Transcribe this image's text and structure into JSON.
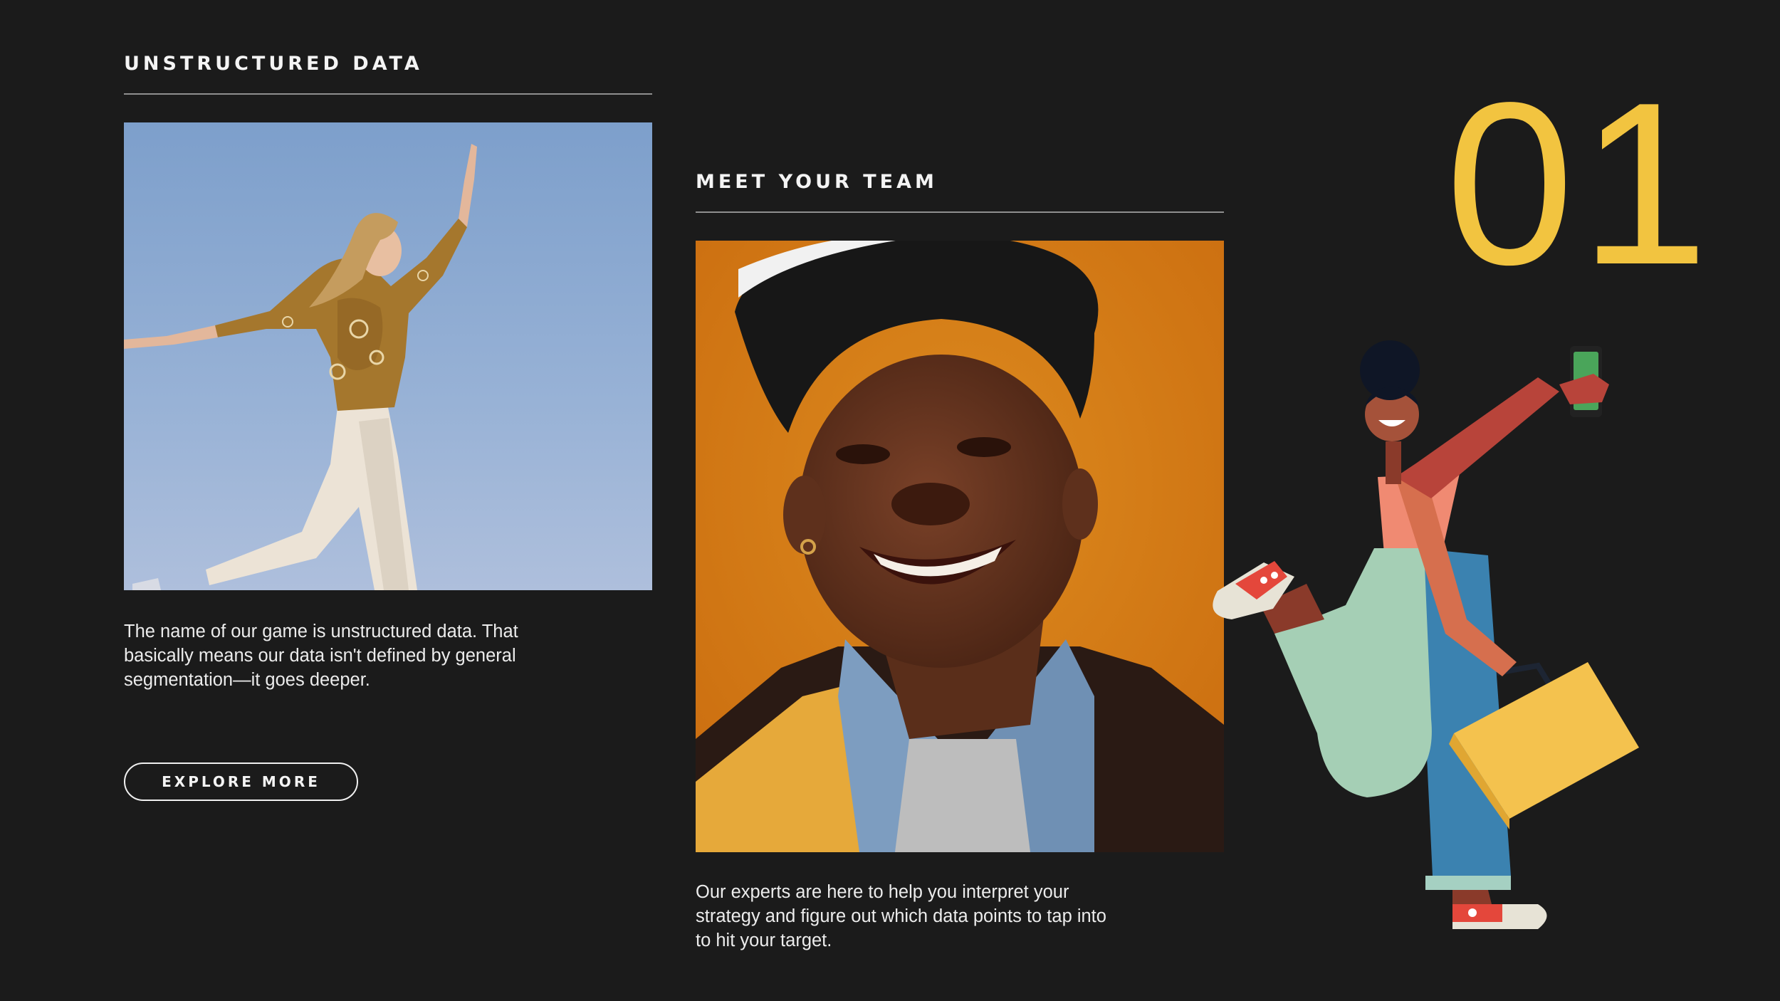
{
  "left_section": {
    "title": "UNSTRUCTURED DATA",
    "body_lines": [
      "The name of our game is unstructured data. That",
      "basically means our data isn't defined by general",
      "segmentation—it goes deeper."
    ],
    "button_label": "EXPLORE MORE"
  },
  "middle_section": {
    "title": "MEET YOUR TEAM",
    "body_lines": [
      "Our experts are here to help you interpret your",
      "strategy and figure out which data points to tap into",
      "to hit your target."
    ]
  },
  "number": "01",
  "colors": {
    "background": "#1b1b1b",
    "accent_yellow": "#f2c440",
    "text": "#f2f2f2"
  }
}
